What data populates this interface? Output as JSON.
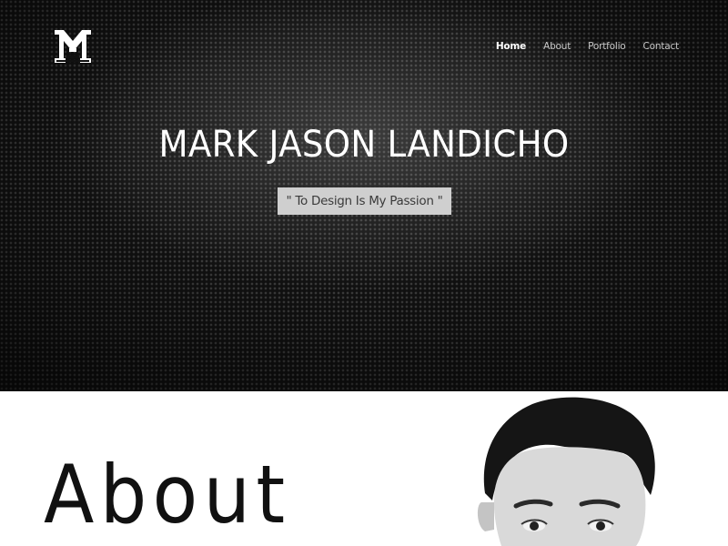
{
  "nav": {
    "items": [
      {
        "label": "Home",
        "active": true
      },
      {
        "label": "About",
        "active": false
      },
      {
        "label": "Portfolio",
        "active": false
      },
      {
        "label": "Contact",
        "active": false
      }
    ]
  },
  "hero": {
    "title": "MARK JASON LANDICHO",
    "tagline": "\" To Design Is My Passion \""
  },
  "about": {
    "heading": "About"
  },
  "colors": {
    "hero_background": "#111111",
    "nav_active": "#ffffff",
    "nav_inactive": "#c8c8c8",
    "tagline_background": "#cfcfcf"
  },
  "icons": {
    "logo": "mj-monogram-logo"
  }
}
